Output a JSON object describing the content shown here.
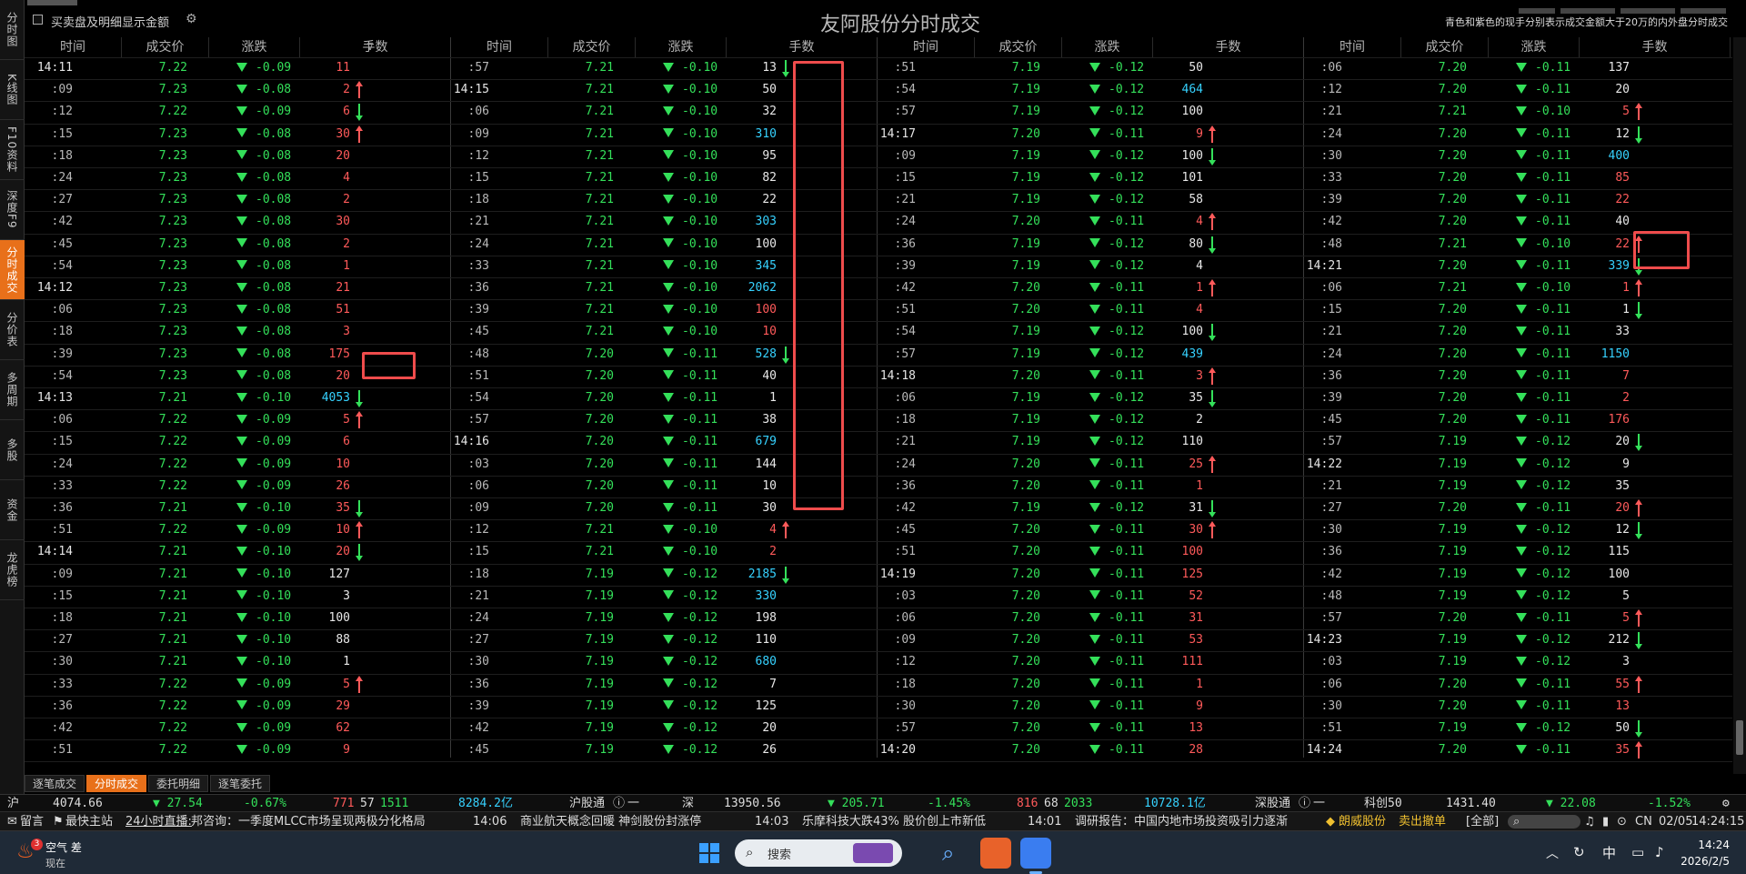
{
  "window": {
    "title": "友阿股份分时成交",
    "note": "青色和紫色的现手分别表示成交金额大于20万的内外盘分时成交",
    "checkbox_label": "买卖盘及明细显示金额"
  },
  "nav": {
    "items": [
      {
        "label": "分时图",
        "active": false
      },
      {
        "label": "K线图",
        "active": false
      },
      {
        "label": "F10资料",
        "active": false
      },
      {
        "label": "深度F9",
        "active": false
      },
      {
        "label": "分时成交",
        "active": true
      },
      {
        "label": "分价表",
        "active": false
      },
      {
        "label": "多周期",
        "active": false
      },
      {
        "label": "多股",
        "active": false
      },
      {
        "label": "资金",
        "active": false
      },
      {
        "label": "龙虎榜",
        "active": false
      }
    ]
  },
  "columns": [
    {
      "time": "时间",
      "price": "成交价",
      "change": "涨跌",
      "volume": "手数"
    },
    {
      "time": "时间",
      "price": "成交价",
      "change": "涨跌",
      "volume": "手数"
    },
    {
      "time": "时间",
      "price": "成交价",
      "change": "涨跌",
      "volume": "手数"
    },
    {
      "time": "时间",
      "price": "成交价",
      "change": "涨跌",
      "volume": "手数"
    }
  ],
  "panels": [
    {
      "rows": [
        [
          "14:11",
          "7.22",
          "-0.09",
          "11",
          "r",
          ""
        ],
        [
          ":09",
          "7.23",
          "-0.08",
          "2",
          "r",
          "up"
        ],
        [
          ":12",
          "7.22",
          "-0.09",
          "6",
          "r",
          "down"
        ],
        [
          ":15",
          "7.23",
          "-0.08",
          "30",
          "r",
          "up"
        ],
        [
          ":18",
          "7.23",
          "-0.08",
          "20",
          "r",
          ""
        ],
        [
          ":24",
          "7.23",
          "-0.08",
          "4",
          "r",
          ""
        ],
        [
          ":27",
          "7.23",
          "-0.08",
          "2",
          "r",
          ""
        ],
        [
          ":42",
          "7.23",
          "-0.08",
          "30",
          "r",
          ""
        ],
        [
          ":45",
          "7.23",
          "-0.08",
          "2",
          "r",
          ""
        ],
        [
          ":54",
          "7.23",
          "-0.08",
          "1",
          "r",
          ""
        ],
        [
          "14:12",
          "7.23",
          "-0.08",
          "21",
          "r",
          ""
        ],
        [
          ":06",
          "7.23",
          "-0.08",
          "51",
          "r",
          ""
        ],
        [
          ":18",
          "7.23",
          "-0.08",
          "3",
          "r",
          ""
        ],
        [
          ":39",
          "7.23",
          "-0.08",
          "175",
          "r",
          ""
        ],
        [
          ":54",
          "7.23",
          "-0.08",
          "20",
          "r",
          ""
        ],
        [
          "14:13",
          "7.21",
          "-0.10",
          "4053",
          "c",
          "down"
        ],
        [
          ":06",
          "7.22",
          "-0.09",
          "5",
          "r",
          "up"
        ],
        [
          ":15",
          "7.22",
          "-0.09",
          "6",
          "r",
          ""
        ],
        [
          ":24",
          "7.22",
          "-0.09",
          "10",
          "r",
          ""
        ],
        [
          ":33",
          "7.22",
          "-0.09",
          "26",
          "r",
          ""
        ],
        [
          ":36",
          "7.21",
          "-0.10",
          "35",
          "r",
          "down"
        ],
        [
          ":51",
          "7.22",
          "-0.09",
          "10",
          "r",
          "up"
        ],
        [
          "14:14",
          "7.21",
          "-0.10",
          "20",
          "r",
          "down"
        ],
        [
          ":09",
          "7.21",
          "-0.10",
          "127",
          "w",
          ""
        ],
        [
          ":15",
          "7.21",
          "-0.10",
          "3",
          "w",
          ""
        ],
        [
          ":18",
          "7.21",
          "-0.10",
          "100",
          "w",
          ""
        ],
        [
          ":27",
          "7.21",
          "-0.10",
          "88",
          "w",
          ""
        ],
        [
          ":30",
          "7.21",
          "-0.10",
          "1",
          "w",
          ""
        ],
        [
          ":33",
          "7.22",
          "-0.09",
          "5",
          "r",
          "up"
        ],
        [
          ":36",
          "7.22",
          "-0.09",
          "29",
          "r",
          ""
        ],
        [
          ":42",
          "7.22",
          "-0.09",
          "62",
          "r",
          ""
        ],
        [
          ":51",
          "7.22",
          "-0.09",
          "9",
          "r",
          ""
        ]
      ]
    },
    {
      "rows": [
        [
          ":57",
          "7.21",
          "-0.10",
          "13",
          "w",
          "down"
        ],
        [
          "14:15",
          "7.21",
          "-0.10",
          "50",
          "w",
          ""
        ],
        [
          ":06",
          "7.21",
          "-0.10",
          "32",
          "w",
          ""
        ],
        [
          ":09",
          "7.21",
          "-0.10",
          "310",
          "c",
          ""
        ],
        [
          ":12",
          "7.21",
          "-0.10",
          "95",
          "w",
          ""
        ],
        [
          ":15",
          "7.21",
          "-0.10",
          "82",
          "w",
          ""
        ],
        [
          ":18",
          "7.21",
          "-0.10",
          "22",
          "w",
          ""
        ],
        [
          ":21",
          "7.21",
          "-0.10",
          "303",
          "c",
          ""
        ],
        [
          ":24",
          "7.21",
          "-0.10",
          "100",
          "w",
          ""
        ],
        [
          ":33",
          "7.21",
          "-0.10",
          "345",
          "c",
          ""
        ],
        [
          ":36",
          "7.21",
          "-0.10",
          "2062",
          "c",
          ""
        ],
        [
          ":39",
          "7.21",
          "-0.10",
          "100",
          "r",
          ""
        ],
        [
          ":45",
          "7.21",
          "-0.10",
          "10",
          "r",
          ""
        ],
        [
          ":48",
          "7.20",
          "-0.11",
          "528",
          "c",
          "down"
        ],
        [
          ":51",
          "7.20",
          "-0.11",
          "40",
          "w",
          ""
        ],
        [
          ":54",
          "7.20",
          "-0.11",
          "1",
          "w",
          ""
        ],
        [
          ":57",
          "7.20",
          "-0.11",
          "38",
          "w",
          ""
        ],
        [
          "14:16",
          "7.20",
          "-0.11",
          "679",
          "c",
          ""
        ],
        [
          ":03",
          "7.20",
          "-0.11",
          "144",
          "w",
          ""
        ],
        [
          ":06",
          "7.20",
          "-0.11",
          "10",
          "w",
          ""
        ],
        [
          ":09",
          "7.20",
          "-0.11",
          "30",
          "w",
          ""
        ],
        [
          ":12",
          "7.21",
          "-0.10",
          "4",
          "r",
          "up"
        ],
        [
          ":15",
          "7.21",
          "-0.10",
          "2",
          "r",
          ""
        ],
        [
          ":18",
          "7.19",
          "-0.12",
          "2185",
          "c",
          "down"
        ],
        [
          ":21",
          "7.19",
          "-0.12",
          "330",
          "c",
          ""
        ],
        [
          ":24",
          "7.19",
          "-0.12",
          "198",
          "w",
          ""
        ],
        [
          ":27",
          "7.19",
          "-0.12",
          "110",
          "w",
          ""
        ],
        [
          ":30",
          "7.19",
          "-0.12",
          "680",
          "c",
          ""
        ],
        [
          ":36",
          "7.19",
          "-0.12",
          "7",
          "w",
          ""
        ],
        [
          ":39",
          "7.19",
          "-0.12",
          "125",
          "w",
          ""
        ],
        [
          ":42",
          "7.19",
          "-0.12",
          "20",
          "w",
          ""
        ],
        [
          ":45",
          "7.19",
          "-0.12",
          "26",
          "w",
          ""
        ]
      ]
    },
    {
      "rows": [
        [
          ":51",
          "7.19",
          "-0.12",
          "50",
          "w",
          ""
        ],
        [
          ":54",
          "7.19",
          "-0.12",
          "464",
          "c",
          ""
        ],
        [
          ":57",
          "7.19",
          "-0.12",
          "100",
          "w",
          ""
        ],
        [
          "14:17",
          "7.20",
          "-0.11",
          "9",
          "r",
          "up"
        ],
        [
          ":09",
          "7.19",
          "-0.12",
          "100",
          "w",
          "down"
        ],
        [
          ":15",
          "7.19",
          "-0.12",
          "101",
          "w",
          ""
        ],
        [
          ":21",
          "7.19",
          "-0.12",
          "58",
          "w",
          ""
        ],
        [
          ":24",
          "7.20",
          "-0.11",
          "4",
          "r",
          "up"
        ],
        [
          ":36",
          "7.19",
          "-0.12",
          "80",
          "w",
          "down"
        ],
        [
          ":39",
          "7.19",
          "-0.12",
          "4",
          "w",
          ""
        ],
        [
          ":42",
          "7.20",
          "-0.11",
          "1",
          "r",
          "up"
        ],
        [
          ":51",
          "7.20",
          "-0.11",
          "4",
          "r",
          ""
        ],
        [
          ":54",
          "7.19",
          "-0.12",
          "100",
          "w",
          "down"
        ],
        [
          ":57",
          "7.19",
          "-0.12",
          "439",
          "c",
          ""
        ],
        [
          "14:18",
          "7.20",
          "-0.11",
          "3",
          "r",
          "up"
        ],
        [
          ":06",
          "7.19",
          "-0.12",
          "35",
          "w",
          "down"
        ],
        [
          ":18",
          "7.19",
          "-0.12",
          "2",
          "w",
          ""
        ],
        [
          ":21",
          "7.19",
          "-0.12",
          "110",
          "w",
          ""
        ],
        [
          ":24",
          "7.20",
          "-0.11",
          "25",
          "r",
          "up"
        ],
        [
          ":36",
          "7.20",
          "-0.11",
          "1",
          "r",
          ""
        ],
        [
          ":42",
          "7.19",
          "-0.12",
          "31",
          "w",
          "down"
        ],
        [
          ":45",
          "7.20",
          "-0.11",
          "30",
          "r",
          "up"
        ],
        [
          ":51",
          "7.20",
          "-0.11",
          "100",
          "r",
          ""
        ],
        [
          "14:19",
          "7.20",
          "-0.11",
          "125",
          "r",
          ""
        ],
        [
          ":03",
          "7.20",
          "-0.11",
          "52",
          "r",
          ""
        ],
        [
          ":06",
          "7.20",
          "-0.11",
          "31",
          "r",
          ""
        ],
        [
          ":09",
          "7.20",
          "-0.11",
          "53",
          "r",
          ""
        ],
        [
          ":12",
          "7.20",
          "-0.11",
          "111",
          "r",
          ""
        ],
        [
          ":18",
          "7.20",
          "-0.11",
          "1",
          "r",
          ""
        ],
        [
          ":30",
          "7.20",
          "-0.11",
          "9",
          "r",
          ""
        ],
        [
          ":57",
          "7.20",
          "-0.11",
          "13",
          "r",
          ""
        ],
        [
          "14:20",
          "7.20",
          "-0.11",
          "28",
          "r",
          ""
        ]
      ]
    },
    {
      "rows": [
        [
          ":06",
          "7.20",
          "-0.11",
          "137",
          "w",
          ""
        ],
        [
          ":12",
          "7.20",
          "-0.11",
          "20",
          "w",
          ""
        ],
        [
          ":21",
          "7.21",
          "-0.10",
          "5",
          "r",
          "up"
        ],
        [
          ":24",
          "7.20",
          "-0.11",
          "12",
          "w",
          "down"
        ],
        [
          ":30",
          "7.20",
          "-0.11",
          "400",
          "c",
          ""
        ],
        [
          ":33",
          "7.20",
          "-0.11",
          "85",
          "r",
          ""
        ],
        [
          ":39",
          "7.20",
          "-0.11",
          "22",
          "r",
          ""
        ],
        [
          ":42",
          "7.20",
          "-0.11",
          "40",
          "w",
          ""
        ],
        [
          ":48",
          "7.21",
          "-0.10",
          "22",
          "r",
          "up"
        ],
        [
          "14:21",
          "7.20",
          "-0.11",
          "339",
          "c",
          "down"
        ],
        [
          ":06",
          "7.21",
          "-0.10",
          "1",
          "r",
          "up"
        ],
        [
          ":15",
          "7.20",
          "-0.11",
          "1",
          "w",
          "down"
        ],
        [
          ":21",
          "7.20",
          "-0.11",
          "33",
          "w",
          ""
        ],
        [
          ":24",
          "7.20",
          "-0.11",
          "1150",
          "c",
          ""
        ],
        [
          ":36",
          "7.20",
          "-0.11",
          "7",
          "r",
          ""
        ],
        [
          ":39",
          "7.20",
          "-0.11",
          "2",
          "r",
          ""
        ],
        [
          ":45",
          "7.20",
          "-0.11",
          "176",
          "r",
          ""
        ],
        [
          ":57",
          "7.19",
          "-0.12",
          "20",
          "w",
          "down"
        ],
        [
          "14:22",
          "7.19",
          "-0.12",
          "9",
          "w",
          ""
        ],
        [
          ":21",
          "7.19",
          "-0.12",
          "35",
          "w",
          ""
        ],
        [
          ":27",
          "7.20",
          "-0.11",
          "20",
          "r",
          "up"
        ],
        [
          ":30",
          "7.19",
          "-0.12",
          "12",
          "w",
          "down"
        ],
        [
          ":36",
          "7.19",
          "-0.12",
          "115",
          "w",
          ""
        ],
        [
          ":42",
          "7.19",
          "-0.12",
          "100",
          "w",
          ""
        ],
        [
          ":48",
          "7.19",
          "-0.12",
          "5",
          "w",
          ""
        ],
        [
          ":57",
          "7.20",
          "-0.11",
          "5",
          "r",
          "up"
        ],
        [
          "14:23",
          "7.19",
          "-0.12",
          "212",
          "w",
          "down"
        ],
        [
          ":03",
          "7.19",
          "-0.12",
          "3",
          "w",
          ""
        ],
        [
          ":06",
          "7.20",
          "-0.11",
          "55",
          "r",
          "up"
        ],
        [
          ":30",
          "7.20",
          "-0.11",
          "13",
          "r",
          ""
        ],
        [
          ":51",
          "7.19",
          "-0.12",
          "50",
          "w",
          "down"
        ],
        [
          "14:24",
          "7.20",
          "-0.11",
          "35",
          "r",
          "up"
        ]
      ]
    }
  ],
  "bottom_tabs": [
    {
      "label": "逐笔成交",
      "active": false
    },
    {
      "label": "分时成交",
      "active": true
    },
    {
      "label": "委托明细",
      "active": false
    },
    {
      "label": "逐笔委托",
      "active": false
    }
  ],
  "index_bar": {
    "sh_label": "沪",
    "sh_value": "4074.66",
    "sh_change": "▼ 27.54",
    "sh_pct": "-0.67%",
    "sh_up": "771",
    "sh_flat": "57",
    "sh_down": "1511",
    "sh_amount": "8284.2亿",
    "sh_connect": "沪股通",
    "sh_connect_val": "一",
    "sz_label": "深",
    "sz_value": "13950.56",
    "sz_change": "▼ 205.71",
    "sz_pct": "-1.45%",
    "sz_up": "816",
    "sz_flat": "68",
    "sz_down": "2033",
    "sz_amount": "10728.1亿",
    "sz_connect": "深股通",
    "sz_connect_val": "一",
    "kc_label": "科创50",
    "kc_value": "1431.40",
    "kc_change": "▼ 22.08",
    "kc_pct": "-1.52%"
  },
  "news_bar": {
    "msg": "留言",
    "hot": "最快主站",
    "live": "24小时直播:",
    "n1": "邦咨询：一季度MLCC市场呈现两极分化格局",
    "t2": "14:06",
    "n2": "商业航天概念回暖 神剑股份封涨停",
    "t3": "14:03",
    "n3": "乐摩科技大跌43% 股价创上市新低",
    "t4": "14:01",
    "n4": "调研报告：中国内地市场投资吸引力逐渐",
    "stock": "朗威股份",
    "action": "卖出撤单",
    "scope": "[全部]"
  },
  "taskbar": {
    "weather": "空气 差",
    "weather_sub": "现在",
    "badge": "3",
    "search_placeholder": "搜索",
    "lang": "中",
    "region": "CN",
    "date": "02/05",
    "clock": "14:24:15",
    "clock2": "14:24",
    "date2": "2026/2/5"
  }
}
